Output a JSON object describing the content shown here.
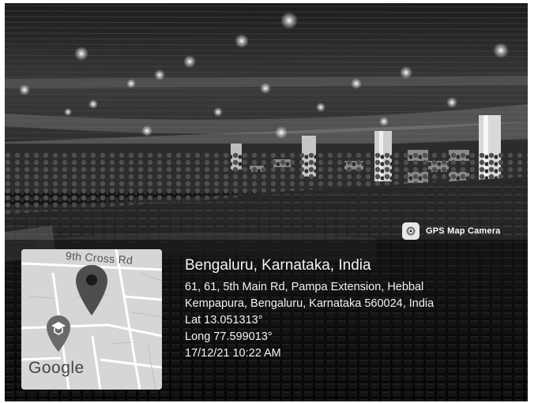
{
  "app_badge": {
    "label": "GPS Map Camera",
    "icon": "camera-icon"
  },
  "map": {
    "road_label": "9th Cross Rd",
    "brand": "Google",
    "icons": [
      "location-pin-icon",
      "school-pin-icon"
    ]
  },
  "location": {
    "title": "Bengaluru, Karnataka, India",
    "address_line1": "61, 61, 5th Main Rd, Pampa Extension, Hebbal",
    "address_line2": "Kempapura, Bengaluru, Karnataka 560024, India",
    "latitude": "Lat 13.051313°",
    "longitude": "Long 77.599013°",
    "timestamp": "17/12/21 10:22 AM"
  }
}
